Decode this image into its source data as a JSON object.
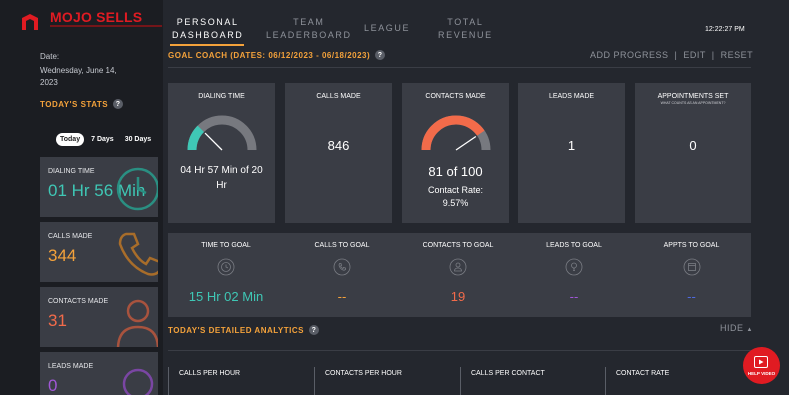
{
  "brand": {
    "name": "MOJO SELLS"
  },
  "sidebar": {
    "date_label": "Date:",
    "date_value": "Wednesday, June 14, 2023",
    "stats_title": "TODAY'S STATS",
    "ranges": [
      "Today",
      "7 Days",
      "30 Days"
    ],
    "stats": [
      {
        "label": "DIALING TIME",
        "value": "01 Hr 56 Min",
        "color": "#3fc7b5"
      },
      {
        "label": "CALLS MADE",
        "value": "344",
        "color": "#f4a23b"
      },
      {
        "label": "CONTACTS MADE",
        "value": "31",
        "color": "#f26b4a"
      },
      {
        "label": "LEADS MADE",
        "value": "0",
        "color": "#a057d6"
      }
    ]
  },
  "nav": {
    "tabs": [
      {
        "line1": "PERSONAL",
        "line2": "DASHBOARD"
      },
      {
        "line1": "TEAM",
        "line2": "LEADERBOARD"
      },
      {
        "line1": "LEAGUE",
        "line2": ""
      },
      {
        "line1": "TOTAL",
        "line2": "REVENUE"
      }
    ],
    "clock": "12:22:27 PM"
  },
  "goal_coach": {
    "title": "GOAL COACH (DATES: 06/12/2023 - 06/18/2023)",
    "actions": [
      "ADD PROGRESS",
      "EDIT",
      "RESET"
    ]
  },
  "metrics": {
    "dialing_time": {
      "title": "DIALING TIME",
      "value": "04 Hr 57 Min of 20 Hr",
      "progress": 0.25
    },
    "calls_made": {
      "title": "CALLS MADE",
      "value": "846"
    },
    "contacts_made": {
      "title": "CONTACTS MADE",
      "value": "81 of 100",
      "progress": 0.81,
      "rate_label": "Contact Rate:",
      "rate_value": "9.57%"
    },
    "leads_made": {
      "title": "LEADS MADE",
      "value": "1"
    },
    "appointments_set": {
      "title": "APPOINTMENTS SET",
      "subtitle": "WHAT COUNTS AS AN APPOINTMENT?",
      "value": "0"
    }
  },
  "to_goal": [
    {
      "title": "TIME TO GOAL",
      "value": "15 Hr 02 Min",
      "color": "#3fc7b5",
      "icon": "clock-icon"
    },
    {
      "title": "CALLS TO GOAL",
      "value": "--",
      "color": "#f4a23b",
      "icon": "phone-icon"
    },
    {
      "title": "CONTACTS TO GOAL",
      "value": "19",
      "color": "#f26b4a",
      "icon": "person-icon"
    },
    {
      "title": "LEADS TO GOAL",
      "value": "--",
      "color": "#a057d6",
      "icon": "lightbulb-icon"
    },
    {
      "title": "APPTS TO GOAL",
      "value": "--",
      "color": "#4f6ae0",
      "icon": "calendar-icon"
    }
  ],
  "analytics": {
    "title": "TODAY'S DETAILED ANALYTICS",
    "hide_label": "HIDE",
    "columns": [
      "CALLS PER HOUR",
      "CONTACTS PER HOUR",
      "CALLS PER CONTACT",
      "CONTACT RATE"
    ]
  },
  "help": {
    "label": "HELP VIDEO"
  }
}
